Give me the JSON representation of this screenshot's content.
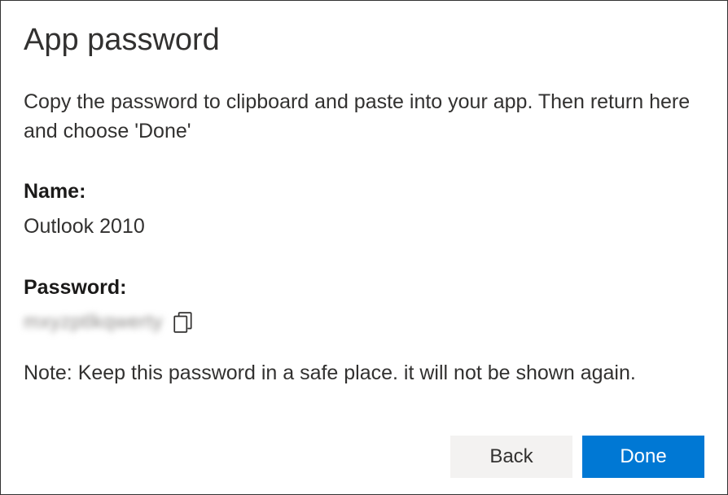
{
  "dialog": {
    "title": "App password",
    "instruction": "Copy the password to clipboard and paste into your app. Then return here and choose 'Done'",
    "name_label": "Name:",
    "name_value": "Outlook 2010",
    "password_label": "Password:",
    "password_value": "mxyzptlkqwerty",
    "note": "Note: Keep this password in a safe place. it will not be shown again.",
    "back_label": "Back",
    "done_label": "Done"
  }
}
